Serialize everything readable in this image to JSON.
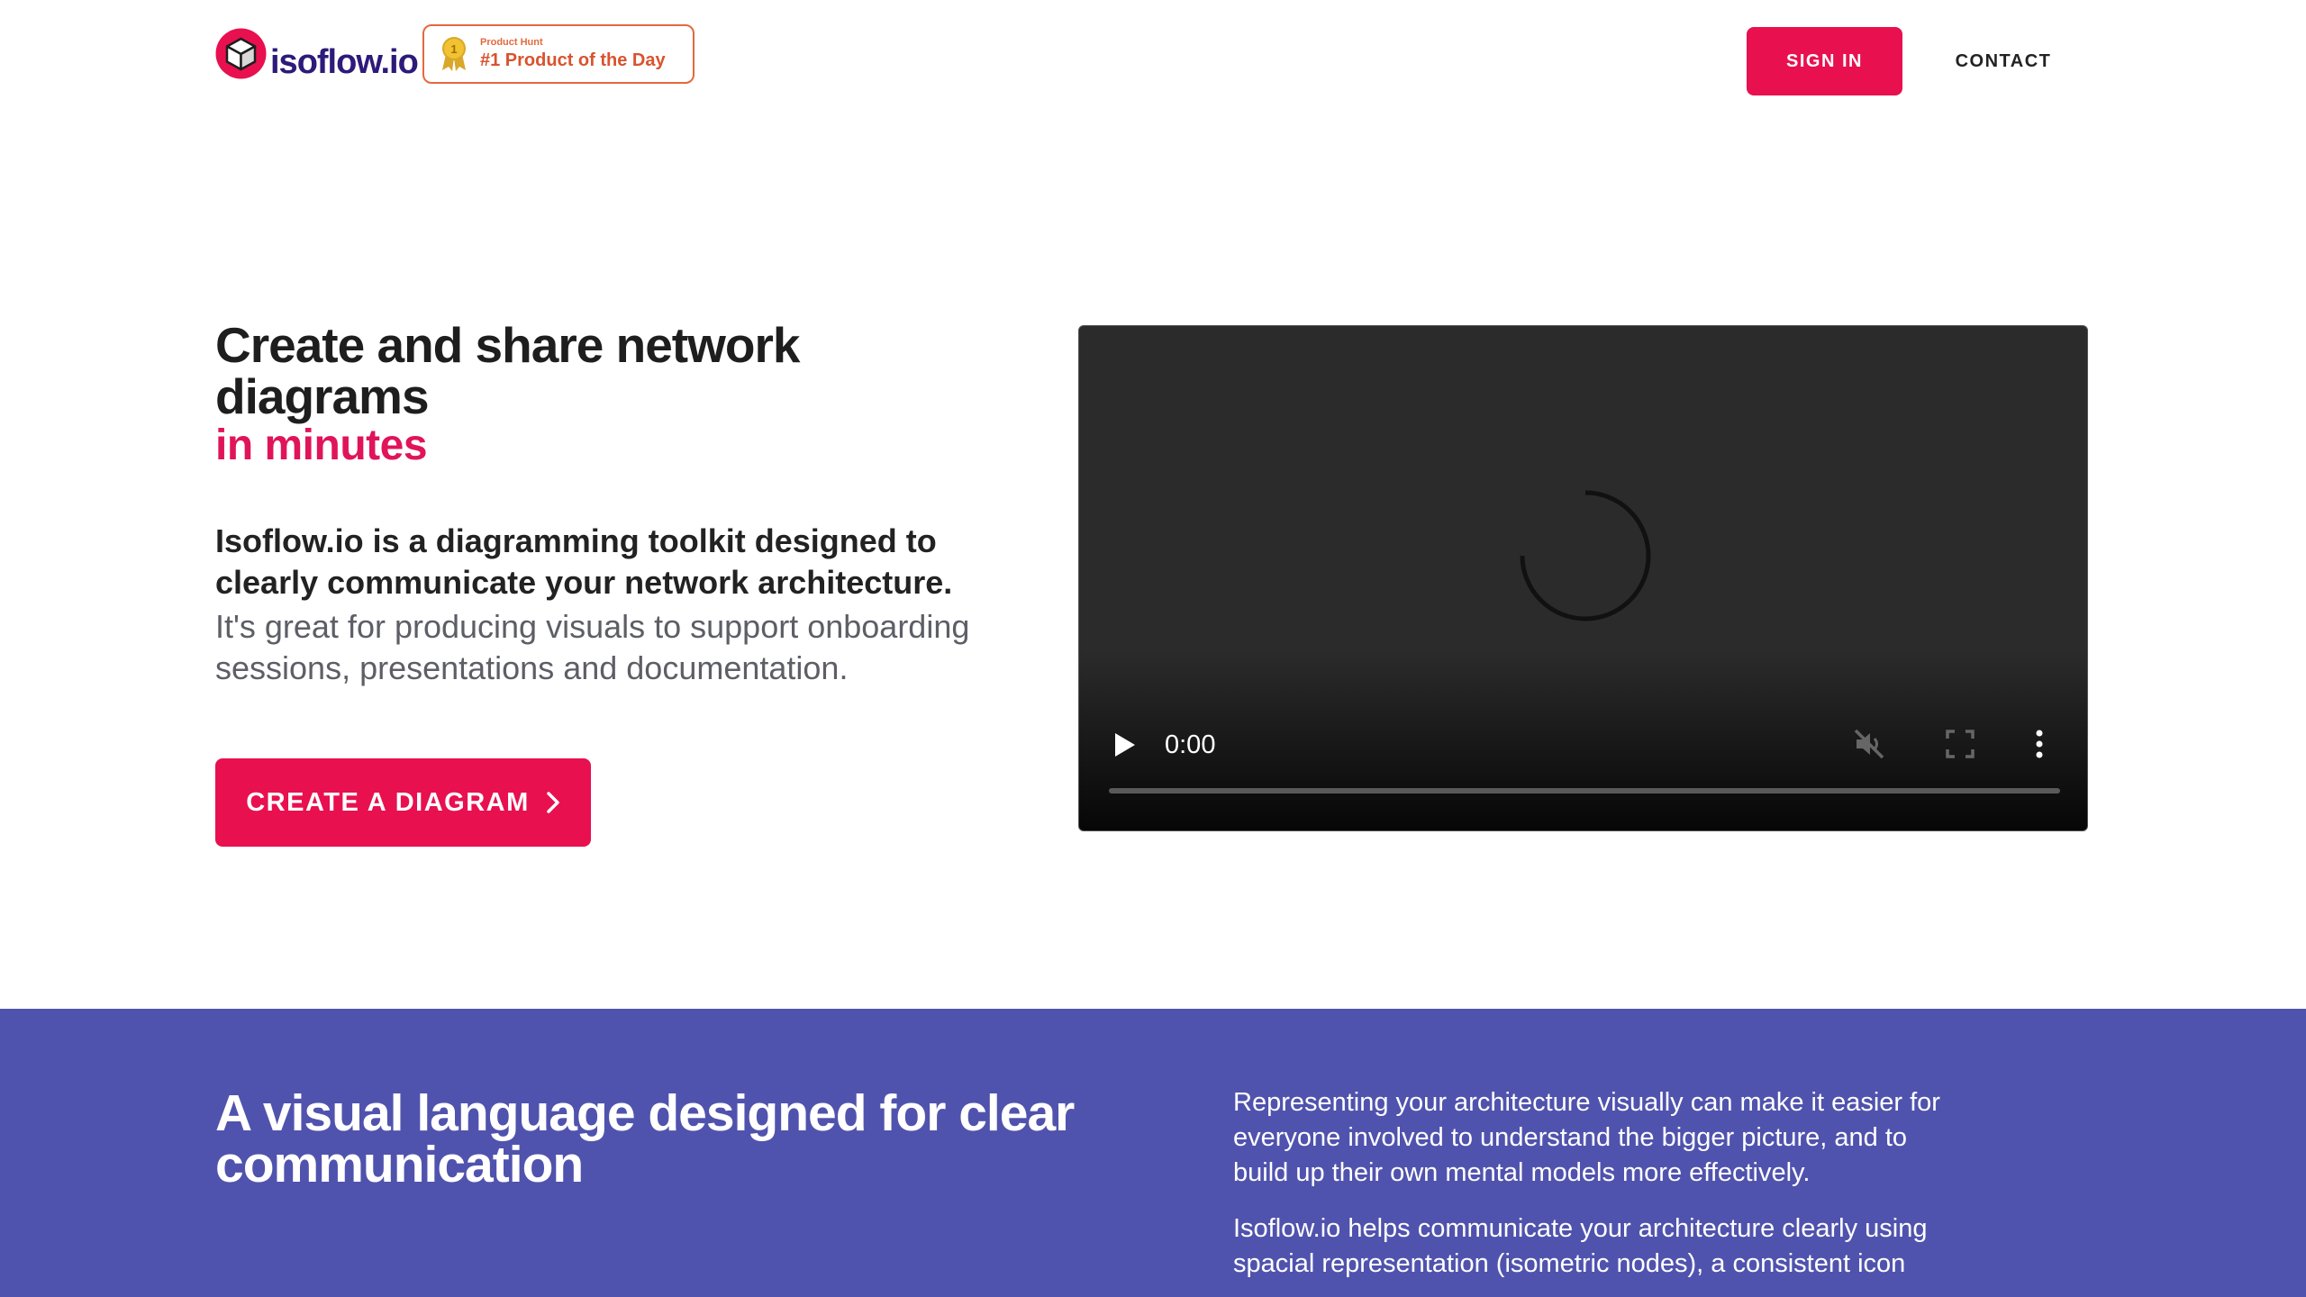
{
  "header": {
    "logo_text": "isoflow.io",
    "badge": {
      "small": "Product Hunt",
      "big": "#1 Product of the Day"
    },
    "sign_in": "SIGN IN",
    "contact": "CONTACT"
  },
  "hero": {
    "title": "Create and share network diagrams",
    "accent": "in minutes",
    "desc_strong": "Isoflow.io is a diagramming toolkit designed to clearly communicate your network architecture.",
    "desc": "It's great for producing visuals to support onboarding sessions, presentations and documentation.",
    "cta": "CREATE A DIAGRAM"
  },
  "video": {
    "time": "0:00",
    "progress": 0
  },
  "section": {
    "title": "A visual language designed for clear communication",
    "text1": "Representing your architecture visually can make it easier for everyone involved to understand the bigger picture, and to build up their own mental models more effectively.",
    "text2": "Isoflow.io helps communicate your architecture clearly using spacial representation (isometric nodes), a consistent icon"
  },
  "colors": {
    "brand": "#e8104f",
    "accent_text": "#e0145a",
    "section_bg": "#5053ad",
    "badge_orange": "#e36a3d"
  },
  "icons": {
    "logo": "isometric-cube-icon",
    "medal": "medal-icon",
    "play": "play-icon",
    "mute": "muted-volume-icon",
    "fullscreen": "fullscreen-icon",
    "more": "more-vertical-icon",
    "chevron": "chevron-right-icon"
  }
}
